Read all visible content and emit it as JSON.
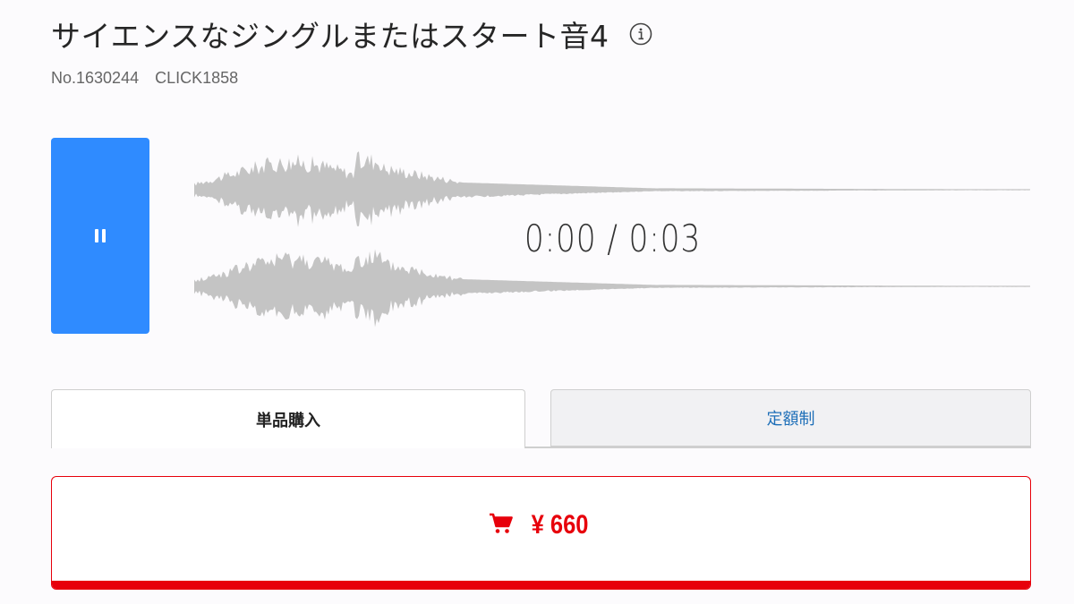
{
  "track": {
    "title": "サイエンスなジングルまたはスタート音4",
    "number": "No.1630244",
    "code": "CLICK1858"
  },
  "player": {
    "state_icon": "pause-icon",
    "time_display": "0:00 / 0:03",
    "accent_color": "#2f8bff",
    "waveform_color": "#c4c4c4"
  },
  "tabs": [
    {
      "label": "単品購入",
      "active": true
    },
    {
      "label": "定額制",
      "active": false
    }
  ],
  "purchase": {
    "icon": "cart-icon",
    "price_label": "¥ 660",
    "accent_color": "#e7000b"
  }
}
